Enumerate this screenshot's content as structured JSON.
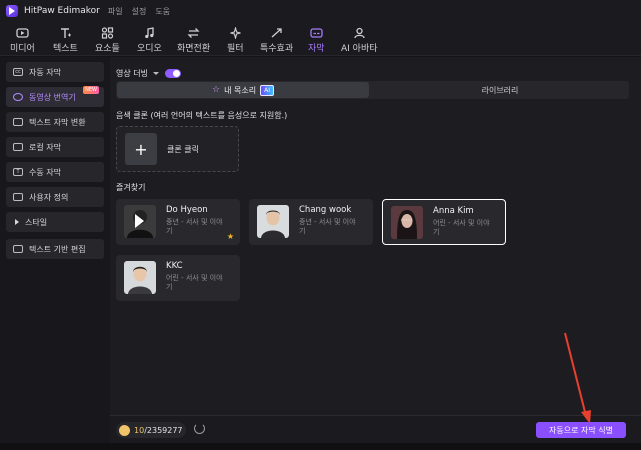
{
  "app": {
    "title": "HitPaw Edimakor"
  },
  "menu": [
    "파일",
    "설정",
    "도움"
  ],
  "toolbar": {
    "items": [
      {
        "label": "미디어",
        "icon": "media-icon"
      },
      {
        "label": "텍스트",
        "icon": "text-icon"
      },
      {
        "label": "요소들",
        "icon": "elements-icon"
      },
      {
        "label": "오디오",
        "icon": "audio-icon"
      },
      {
        "label": "화면전환",
        "icon": "transition-icon"
      },
      {
        "label": "필터",
        "icon": "filter-icon"
      },
      {
        "label": "특수효과",
        "icon": "effects-icon"
      },
      {
        "label": "자막",
        "icon": "subtitle-icon"
      },
      {
        "label": "AI 아바타",
        "icon": "avatar-icon"
      }
    ],
    "active": "자막"
  },
  "sidebar": {
    "items": [
      {
        "label": "자동 자막",
        "icon": "cc-icon"
      },
      {
        "label": "동영상 번역기",
        "icon": "translate-icon",
        "badge": "NEW"
      },
      {
        "label": "텍스트 자막 변환",
        "icon": "text-convert-icon"
      },
      {
        "label": "로컬 자막",
        "icon": "local-subtitle-icon"
      },
      {
        "label": "수동 자막",
        "icon": "manual-subtitle-icon"
      },
      {
        "label": "사용자 정의",
        "icon": "custom-icon"
      },
      {
        "label": "스타일",
        "icon": "triangle-icon"
      },
      {
        "label": "텍스트 기반 편집",
        "icon": "text-edit-icon"
      }
    ],
    "active": "동영상 번역기"
  },
  "main": {
    "dub_label": "영상 더빙",
    "tabs": [
      {
        "label": "내 목소리",
        "chip": "AI"
      },
      {
        "label": "라이브러리"
      }
    ],
    "clone_desc": "음색 클론 (여러 언어의 텍스트를 음성으로 지원함.)",
    "clone_label": "클론 클릭",
    "fav_title": "즐겨찾기",
    "voices": [
      {
        "name": "Do Hyeon",
        "desc": "중년 - 서사 및 이야기",
        "favorite": true
      },
      {
        "name": "Chang wook",
        "desc": "중년 - 서사 및 이야기"
      },
      {
        "name": "Anna Kim",
        "desc": "어린 - 서사 및 이야기",
        "selected": true
      },
      {
        "name": "KKC",
        "desc": "어린 - 서사 및 이야기"
      }
    ]
  },
  "bottom": {
    "credits_used": "10",
    "credits_total": "/2359277",
    "recognize_label": "자동으로 자막 식별"
  },
  "colors": {
    "accent": "#8a4fff",
    "background": "#1d1d21",
    "annotation": "#e8402e"
  }
}
